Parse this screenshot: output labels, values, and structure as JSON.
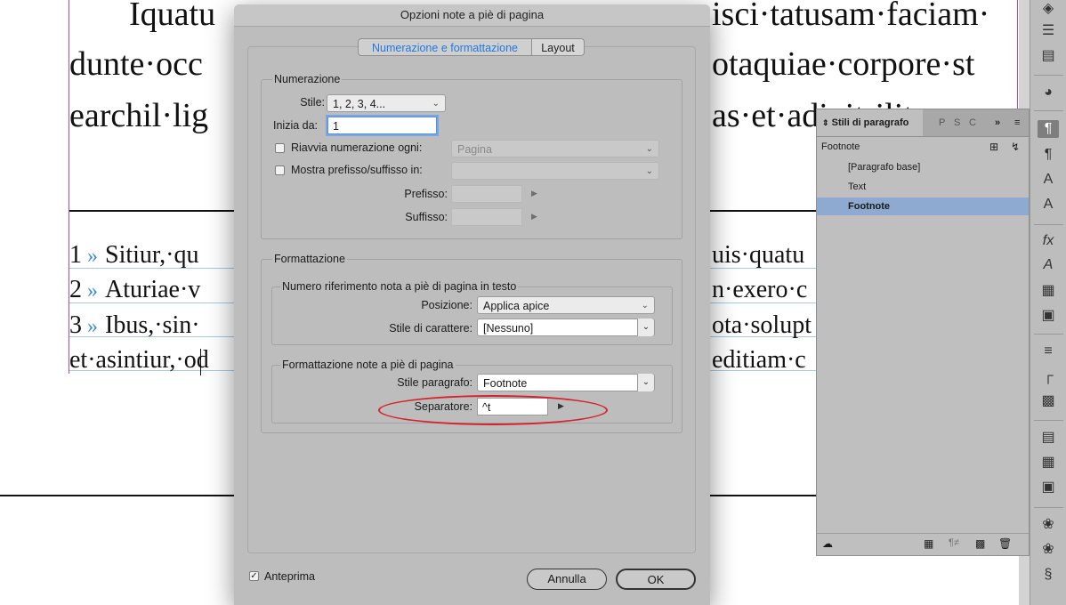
{
  "document": {
    "lines": [
      "Iquatu·... rlit...t... ...nti· l· isci·tatusam·faciam·",
      "dunte·occ",
      "earchil·lig"
    ],
    "lines_right": [
      "isci·tatusam·faciam·",
      "otaquiae·corpore·st",
      "as·et·adipit·ilit"
    ],
    "line0_left": "Iquatu",
    "footnotes": [
      {
        "num": "1",
        "sep": "»",
        "left": "Sitiur,·qu",
        "right": "uis·quatu"
      },
      {
        "num": "2",
        "sep": "»",
        "left": "Aturiae·v",
        "right": "n·exero·c"
      },
      {
        "num": "3",
        "sep": "»",
        "left": "Ibus,·sin·",
        "right": "ota·solupt"
      }
    ],
    "last_left": "et·asintiur,·od",
    "last_right": "editiam·c"
  },
  "dialog": {
    "title": "Opzioni note a piè di pagina",
    "tabs": [
      "Numerazione e formattazione",
      "Layout"
    ],
    "numbering": {
      "title": "Numerazione",
      "style_label": "Stile:",
      "style_value": "1, 2, 3, 4...",
      "start_label": "Inizia da:",
      "start_value": "1",
      "restart_label": "Riavvia numerazione ogni:",
      "restart_value": "Pagina",
      "prefix_show_label": "Mostra prefisso/suffisso in:",
      "prefix_label": "Prefisso:",
      "suffix_label": "Suffisso:"
    },
    "formatting": {
      "title": "Formattazione",
      "ref_group_title": "Numero riferimento nota a piè di pagina in testo",
      "position_label": "Posizione:",
      "position_value": "Applica apice",
      "char_style_label": "Stile di carattere:",
      "char_style_value": "[Nessuno]",
      "notes_group_title": "Formattazione note a piè di pagina",
      "para_style_label": "Stile paragrafo:",
      "para_style_value": "Footnote",
      "separator_label": "Separatore:",
      "separator_value": "^t"
    },
    "preview_label": "Anteprima",
    "preview_checked": true,
    "cancel_label": "Annulla",
    "ok_label": "OK"
  },
  "panel": {
    "tab_active": "Stili di paragrafo",
    "tab_others": [
      "P",
      "S",
      "C"
    ],
    "current_style": "Footnote",
    "items": [
      "[Paragrafo base]",
      "Text",
      "Footnote"
    ],
    "selected_index": 2
  },
  "toolbar": {
    "icons": [
      "layers-icon",
      "stroke-icon",
      "gradient-icon",
      "cc-libraries-icon",
      "paragraph-styles-icon",
      "paragraph-icon",
      "character-styles-icon",
      "character-icon",
      "effects-icon",
      "glyphs-icon",
      "table-icon",
      "text-wrap-icon",
      "align-icon",
      "pathfinder-icon",
      "table-styles-icon",
      "cell-styles-icon",
      "object-styles-icon",
      "links-icon",
      "pages-icon",
      "swatches-icon"
    ]
  },
  "colors": {
    "accent_blue": "#1f7ae0",
    "highlight_red": "#d6202a",
    "selection": "#8eaad0",
    "frame_magenta": "#c23ec2"
  }
}
